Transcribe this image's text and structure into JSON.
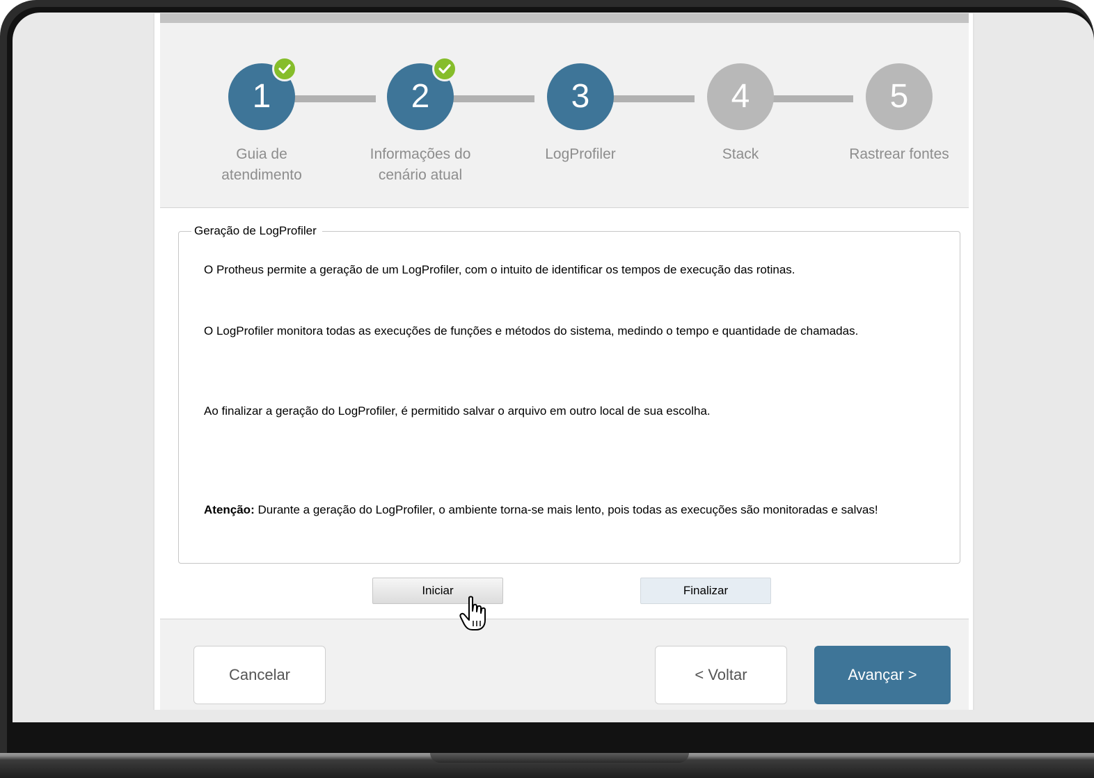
{
  "wizard": {
    "steps": [
      {
        "number": "1",
        "label_line1": "Guia de",
        "label_line2": "atendimento",
        "state": "done"
      },
      {
        "number": "2",
        "label_line1": "Informações do",
        "label_line2": "cenário atual",
        "state": "done"
      },
      {
        "number": "3",
        "label_line1": "LogProfiler",
        "label_line2": "",
        "state": "active"
      },
      {
        "number": "4",
        "label_line1": "Stack",
        "label_line2": "",
        "state": "pending"
      },
      {
        "number": "5",
        "label_line1": "Rastrear fontes",
        "label_line2": "",
        "state": "pending"
      }
    ],
    "colors": {
      "done": "#3e7598",
      "active": "#3e7598",
      "pending": "#b8b8b8",
      "check": "#86bd2b"
    }
  },
  "content": {
    "legend": "Geração de LogProfiler",
    "paragraphs": {
      "p1": "O Protheus permite a geração de um LogProfiler, com o intuito de identificar os tempos de execução das rotinas.",
      "p2": "O LogProfiler monitora todas as execuções de funções e métodos do sistema, medindo o tempo e quantidade de chamadas.",
      "p3": "Ao finalizar a geração do LogProfiler, é permitido salvar o arquivo em outro local de sua escolha.",
      "warning_label": "Atenção:",
      "warning_text": " Durante a geração do LogProfiler, o ambiente torna-se mais lento, pois todas as execuções são monitoradas e salvas!"
    },
    "buttons": {
      "start": "Iniciar",
      "finish": "Finalizar"
    }
  },
  "footer": {
    "cancel": "Cancelar",
    "back": "< Voltar",
    "next": "Avançar >"
  },
  "icons": {
    "cursor": "hand-pointer-icon",
    "check": "checkmark-icon"
  }
}
